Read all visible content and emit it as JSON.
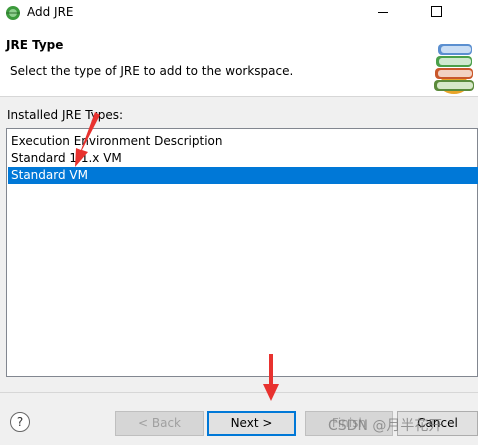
{
  "window": {
    "title": "Add JRE"
  },
  "header": {
    "title": "JRE Type",
    "description": "Select the type of JRE to add to the workspace."
  },
  "list": {
    "label": "Installed JRE Types:",
    "items": [
      {
        "label": "Execution Environment Description",
        "selected": false
      },
      {
        "label": "Standard 1.1.x VM",
        "selected": false
      },
      {
        "label": "Standard VM",
        "selected": true
      }
    ]
  },
  "footer": {
    "help_icon": "?",
    "back_label": "< Back",
    "next_label": "Next >",
    "finish_label": "Finish",
    "cancel_label": "Cancel"
  },
  "watermark": "CSDN @月半花开",
  "colors": {
    "selection": "#0078d7",
    "annotation_arrow": "#e8322f"
  }
}
